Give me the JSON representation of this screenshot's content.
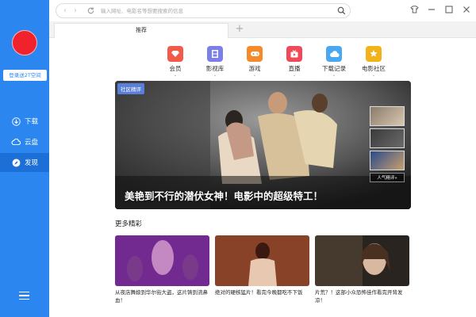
{
  "sidebar": {
    "login_label": "登录送2T空间",
    "items": [
      {
        "label": "下载",
        "icon": "download-icon"
      },
      {
        "label": "云盘",
        "icon": "cloud-icon"
      },
      {
        "label": "发现",
        "icon": "compass-icon",
        "active": true
      }
    ]
  },
  "toolbar": {
    "search_placeholder": "输入网址、电影名等想要搜索的信息"
  },
  "tabs": [
    {
      "label": "推荐"
    }
  ],
  "categories": [
    {
      "label": "会员",
      "icon": "diamond-icon",
      "color": "#f25a4a"
    },
    {
      "label": "影视库",
      "icon": "film-icon",
      "color": "#7b7fe8"
    },
    {
      "label": "游戏",
      "icon": "gamepad-icon",
      "color": "#f58a2a"
    },
    {
      "label": "直播",
      "icon": "live-tv-icon",
      "color": "#f04a5a"
    },
    {
      "label": "下载记录",
      "icon": "cloud-download-icon",
      "color": "#4aa8f0"
    },
    {
      "label": "电影社区",
      "icon": "community-icon",
      "color": "#f2b21a"
    }
  ],
  "hero": {
    "tag": "社区精评",
    "title": "美艳到不行的潜伏女神！电影中的超级特工！",
    "more_label": "人气精评»"
  },
  "more": {
    "title": "更多精彩",
    "cards": [
      {
        "caption": "从夜店舞娘到华尔街大盗，这片铸到流鼻血！"
      },
      {
        "caption": "绝对的硬核猛片！看完今晚都吃不下饭"
      },
      {
        "caption": "片荒？！这部小众恐怖佳作看完开背发凉！"
      }
    ]
  }
}
